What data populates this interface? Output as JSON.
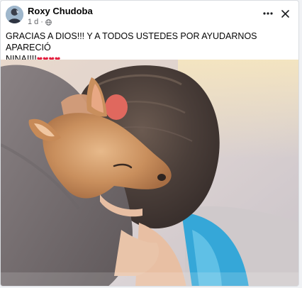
{
  "post": {
    "author": "Roxy Chudoba",
    "time": "1 d",
    "separator": "·",
    "audience_icon": "globe-icon",
    "text_line1": "GRACIAS A DIOS!!! Y A TODOS USTEDES POR AYUDARNOS APARECIÓ",
    "text_line2": "NINA!!!!",
    "hearts": "❤❤❤❤",
    "hearts_color": "#e41e3f",
    "more_icon": "more-horizontal-icon",
    "close_icon": "close-icon"
  },
  "photo": {
    "description_icon": "photo-dog-and-child"
  }
}
